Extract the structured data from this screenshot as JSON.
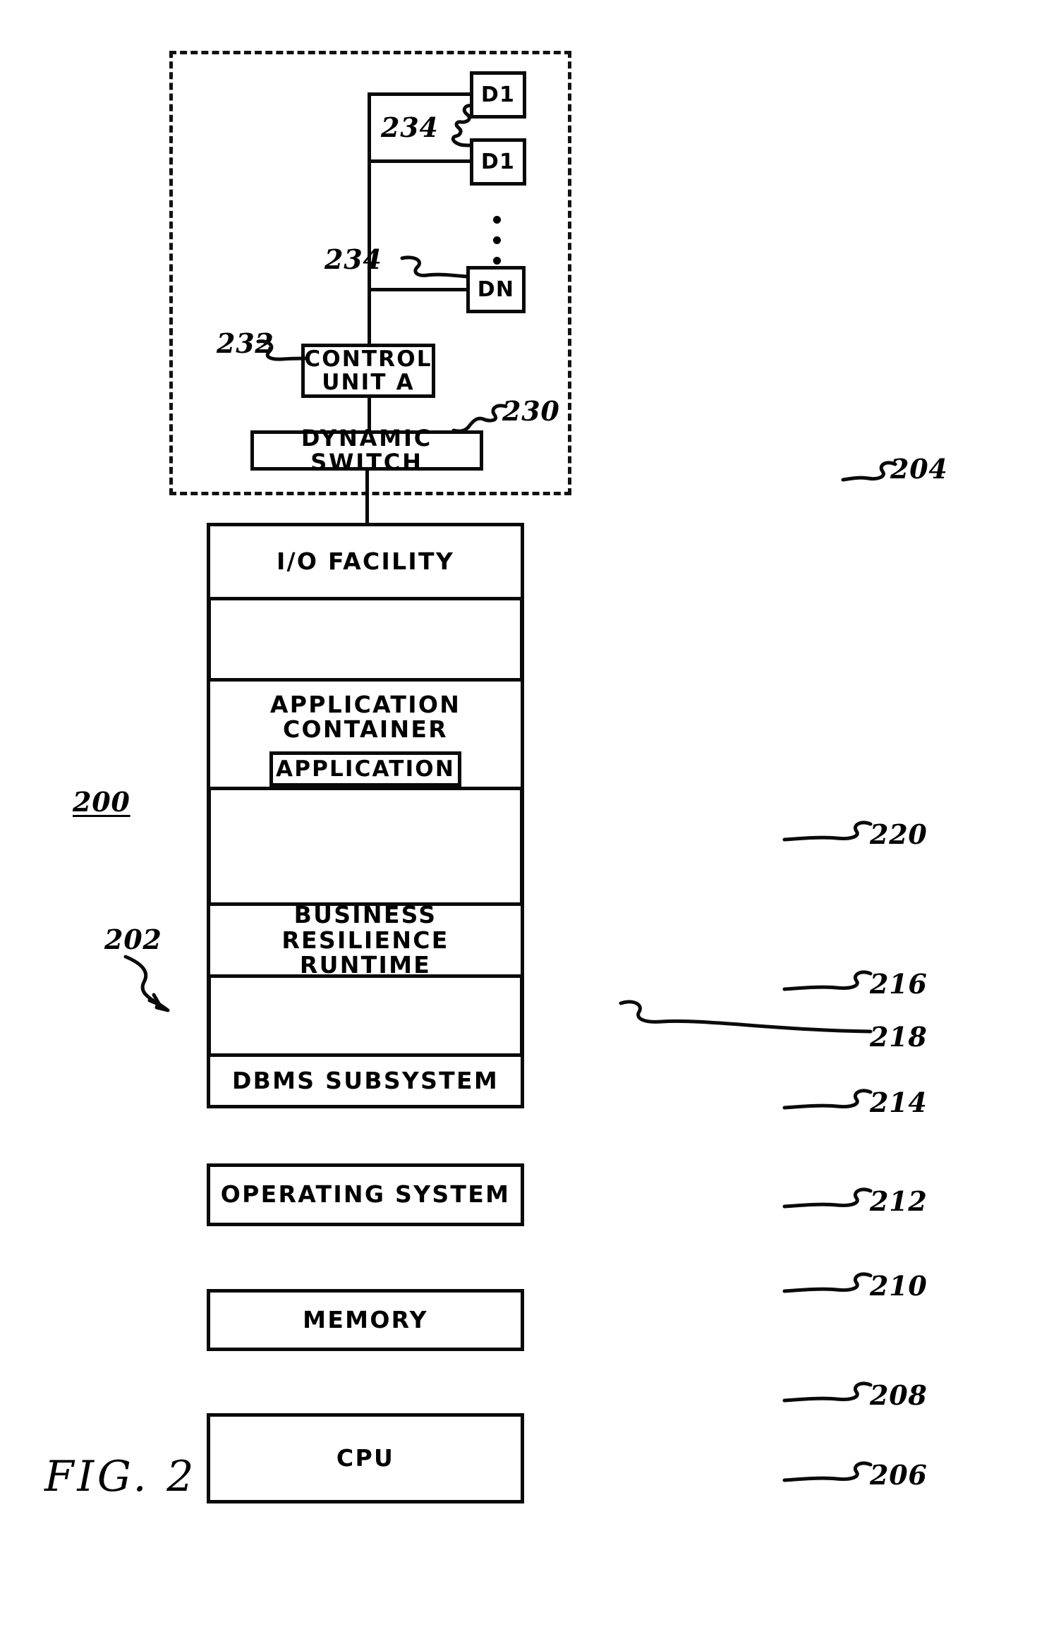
{
  "figure": {
    "caption": "FIG. 2",
    "system_ref": "200",
    "host_ref": "202",
    "io_subsystem_ref": "204"
  },
  "io_subsystem": {
    "devices": [
      {
        "label": "D1",
        "ref": "234"
      },
      {
        "label": "D1",
        "ref": "234"
      },
      {
        "label": "DN",
        "ref": "234"
      }
    ],
    "control_unit": {
      "label": "CONTROL\nUNIT A",
      "ref": "232"
    },
    "dynamic_switch": {
      "label": "DYNAMIC SWITCH",
      "ref": "230"
    },
    "ellipsis": "⋮"
  },
  "stack": {
    "rows": [
      {
        "label": "I/O FACILITY",
        "ref": "220"
      },
      {
        "label": "APPLICATION CONTAINER",
        "ref": "216",
        "inner": {
          "label": "APPLICATION",
          "ref": "218"
        }
      },
      {
        "label": "BUSINESS RESILIENCE\nRUNTIME",
        "ref": "214"
      },
      {
        "label": "DBMS SUBSYSTEM",
        "ref": "212"
      },
      {
        "label": "OPERATING SYSTEM",
        "ref": "210"
      },
      {
        "label": "MEMORY",
        "ref": "208"
      },
      {
        "label": "CPU",
        "ref": "206"
      }
    ]
  },
  "colors": {
    "ink": "#0a0a0a",
    "paper": "#ffffff"
  }
}
